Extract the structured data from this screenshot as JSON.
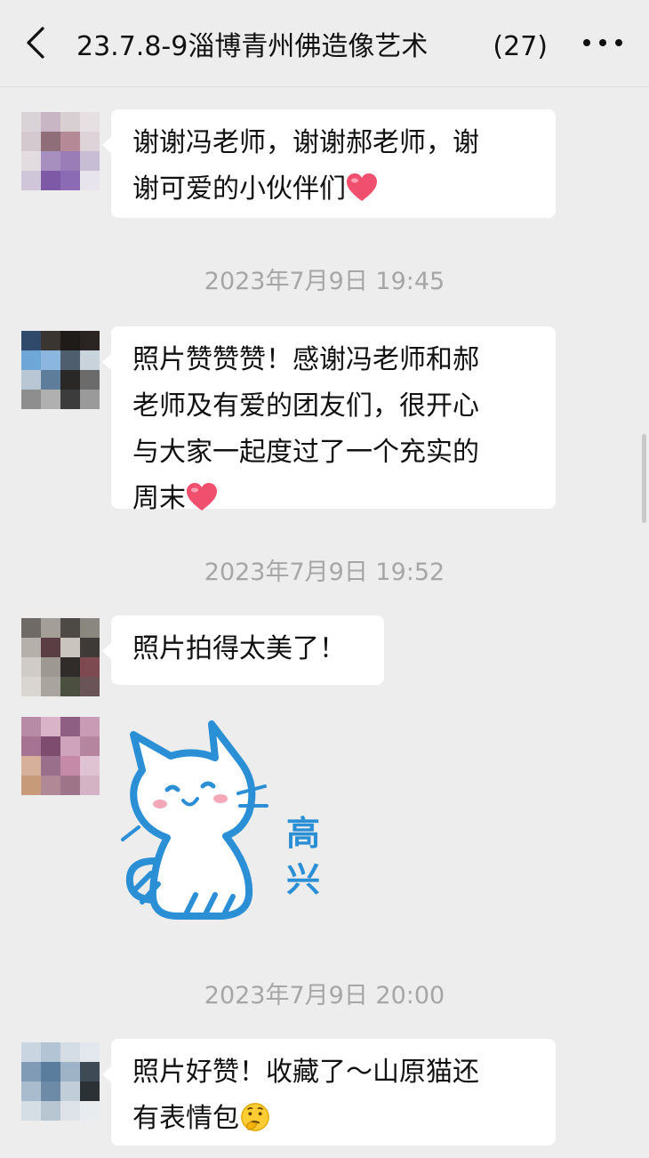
{
  "header": {
    "title": "23.7.8-9淄博青州佛造像艺术",
    "member_count": "(27)"
  },
  "messages": [
    {
      "lines": [
        "谢谢冯老师，谢谢郝老师，谢",
        "谢可爱的小伙伴们"
      ],
      "emoji": "heart-emoji"
    },
    {
      "lines": [
        "照片赞赞赞！感谢冯老师和郝",
        "老师及有爱的团友们，很开心",
        "与大家一起度过了一个充实的",
        "周末"
      ],
      "emoji": "heart-emoji"
    },
    {
      "lines": [
        "照片拍得太美了！"
      ]
    },
    {
      "sticker_text": [
        "高",
        "兴"
      ],
      "sticker_icon": "happy-cat-sticker"
    },
    {
      "lines": [
        "照片好赞！收藏了～山原猫还",
        "有表情包"
      ],
      "emoji": "thinking-face-emoji"
    }
  ],
  "timestamps": [
    "2023年7月9日 19:45",
    "2023年7月9日 19:52",
    "2023年7月9日 20:00"
  ],
  "colors": {
    "background": "#ededed",
    "bubble": "#ffffff",
    "timestamp": "#a6a6a6",
    "heart": "#f0506e",
    "sticker_blue": "#2b8fd6"
  }
}
